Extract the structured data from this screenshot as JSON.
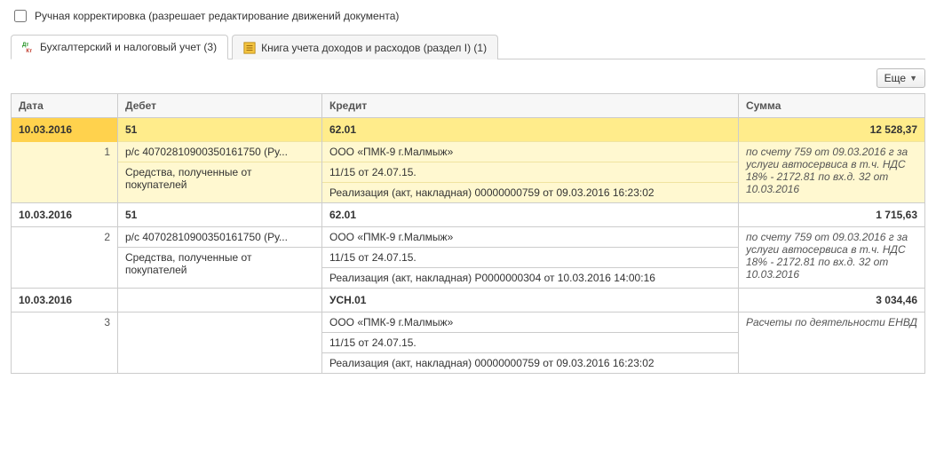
{
  "checkbox": {
    "label": "Ручная корректировка (разрешает редактирование движений документа)"
  },
  "tabs": [
    {
      "label": "Бухгалтерский и налоговый учет (3)"
    },
    {
      "label": "Книга учета доходов и расходов (раздел I) (1)"
    }
  ],
  "more_label": "Еще",
  "headers": {
    "date": "Дата",
    "debit": "Дебет",
    "credit": "Кредит",
    "sum": "Сумма"
  },
  "rows": [
    {
      "date": "10.03.2016",
      "num": "1",
      "debit_acc": "51",
      "credit_acc": "62.01",
      "sum": "12 528,37",
      "debit_lines": [
        "р/с 40702810900350161750 (Ру...",
        "Средства, полученные от покупателей"
      ],
      "credit_lines": [
        "ООО «ПМК-9 г.Малмыж»",
        "11/15 от 24.07.15.",
        "Реализация (акт, накладная) 00000000759 от 09.03.2016 16:23:02"
      ],
      "sum_desc": "по счету 759 от 09.03.2016 г за услуги автосервиса в т.ч. НДС 18% - 2172.81 по вх.д. 32 от 10.03.2016"
    },
    {
      "date": "10.03.2016",
      "num": "2",
      "debit_acc": "51",
      "credit_acc": "62.01",
      "sum": "1 715,63",
      "debit_lines": [
        "р/с 40702810900350161750 (Ру...",
        "Средства, полученные от покупателей"
      ],
      "credit_lines": [
        "ООО «ПМК-9 г.Малмыж»",
        "11/15 от 24.07.15.",
        "Реализация (акт, накладная) Р0000000304 от 10.03.2016 14:00:16"
      ],
      "sum_desc": "по счету 759 от 09.03.2016 г за услуги автосервиса в т.ч. НДС 18% - 2172.81 по вх.д. 32 от 10.03.2016"
    },
    {
      "date": "10.03.2016",
      "num": "3",
      "debit_acc": "",
      "credit_acc": "УСН.01",
      "sum": "3 034,46",
      "debit_lines": [],
      "credit_lines": [
        "ООО «ПМК-9 г.Малмыж»",
        "11/15 от 24.07.15.",
        "Реализация (акт, накладная) 00000000759 от 09.03.2016 16:23:02"
      ],
      "sum_desc": "Расчеты по деятельности ЕНВД"
    }
  ]
}
